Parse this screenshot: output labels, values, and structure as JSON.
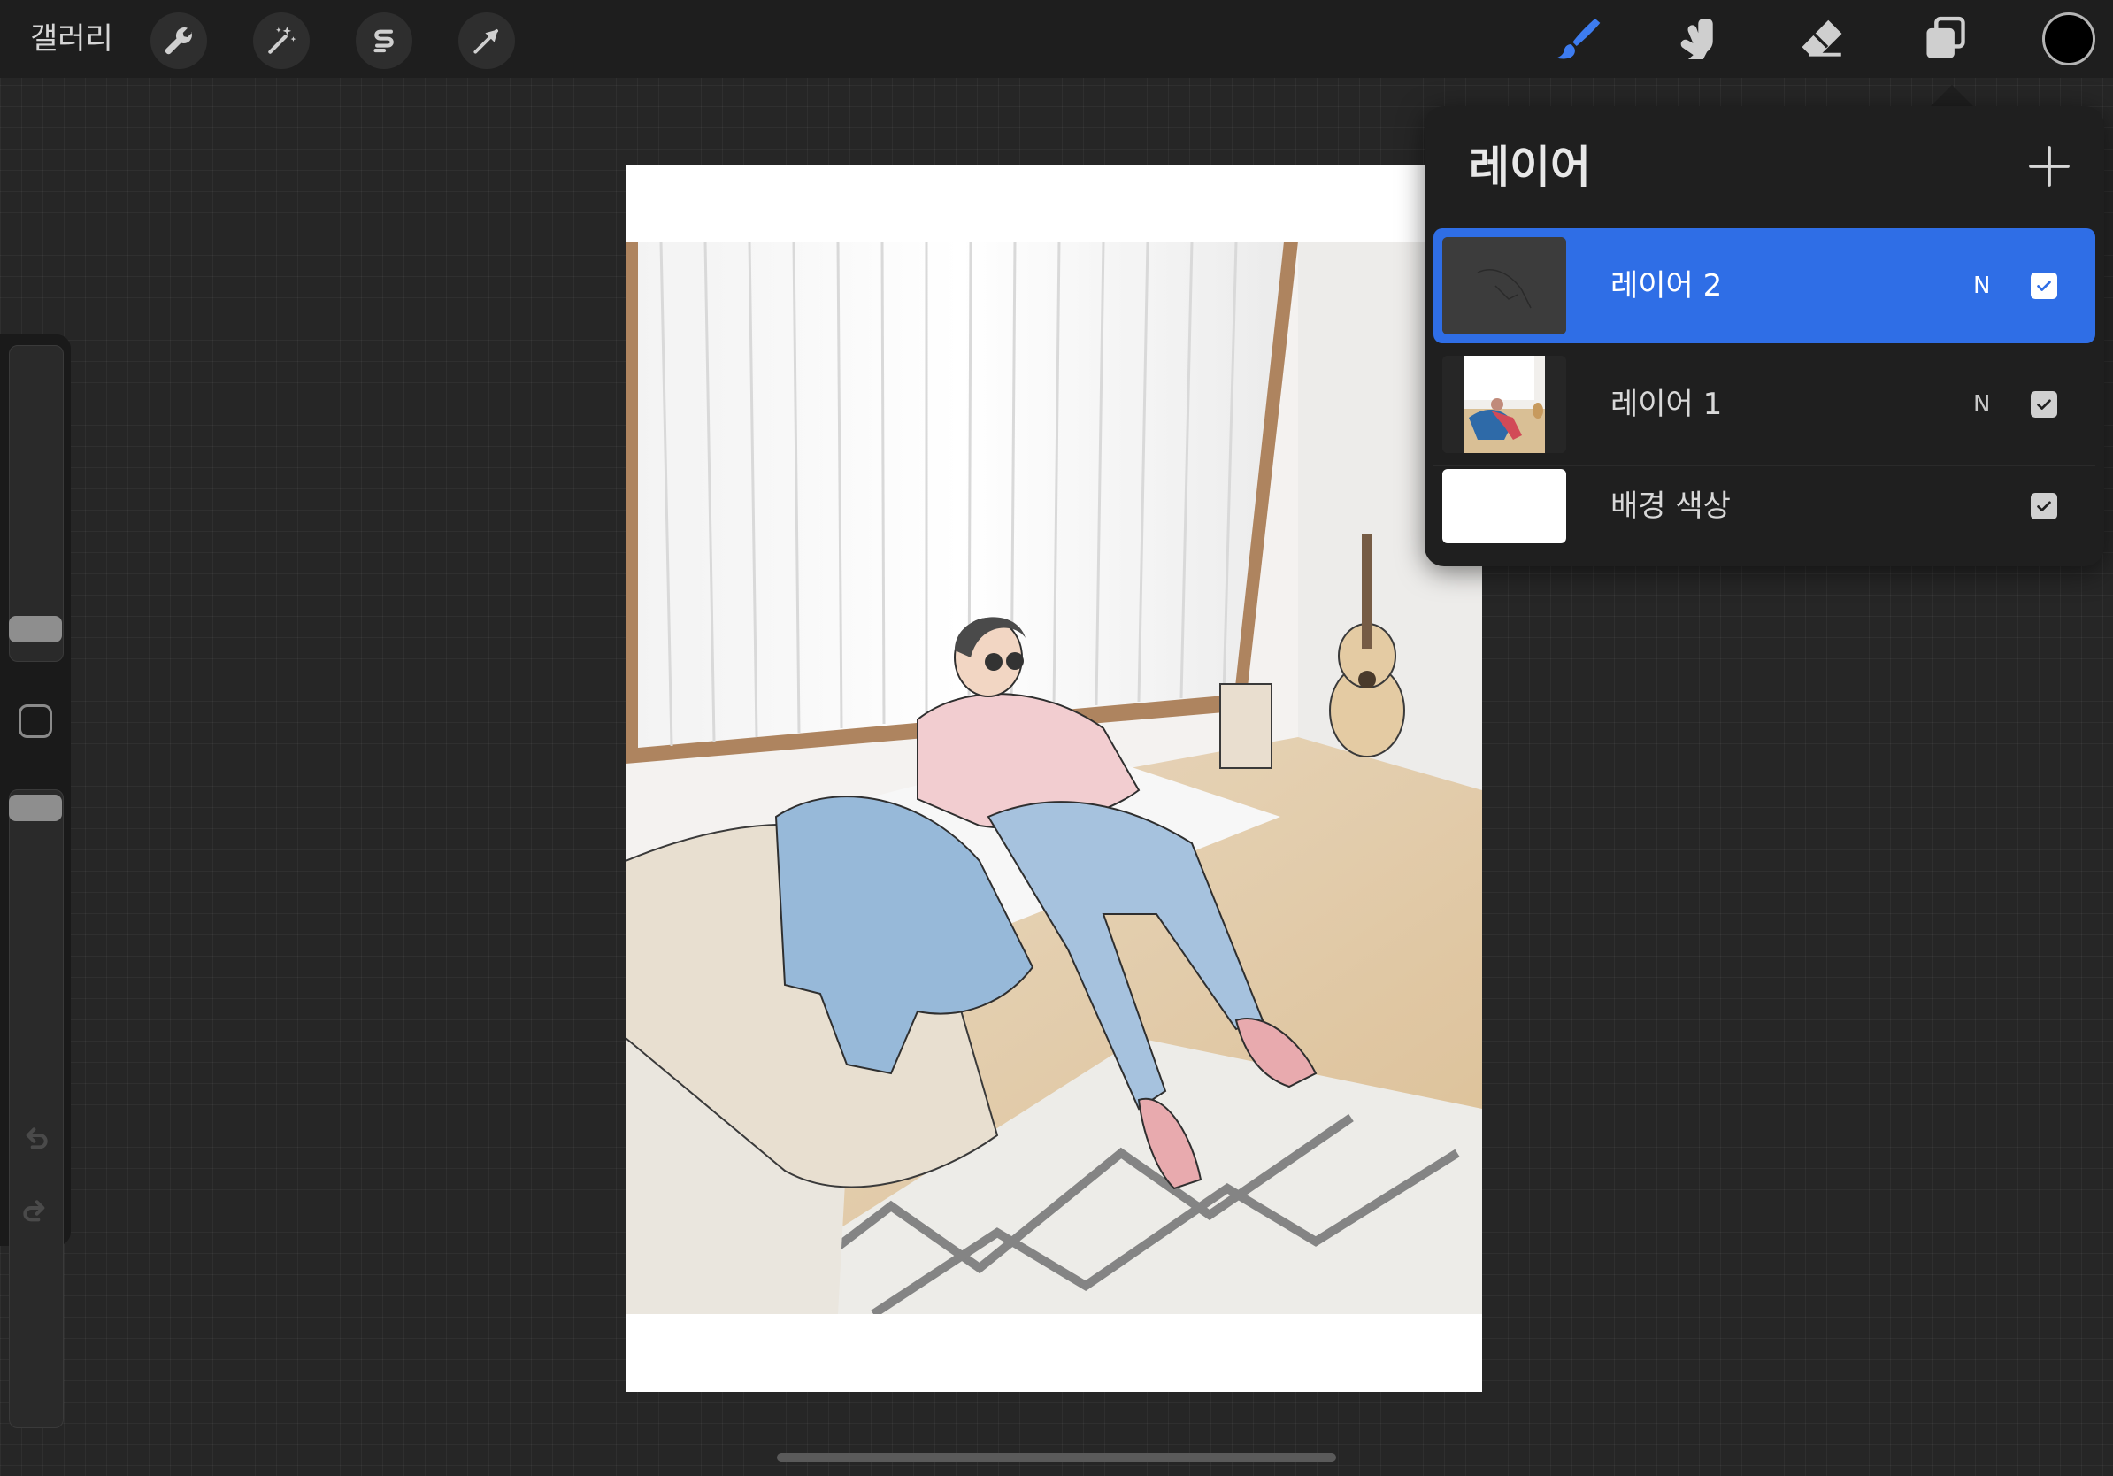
{
  "toolbar": {
    "gallery_label": "갤러리",
    "left_tools": [
      {
        "name": "actions",
        "icon": "wrench-icon"
      },
      {
        "name": "adjustments",
        "icon": "magic-wand-icon"
      },
      {
        "name": "selection",
        "icon": "selection-s-icon"
      },
      {
        "name": "transform",
        "icon": "arrow-cursor-icon"
      }
    ],
    "right_tools": [
      {
        "name": "brush",
        "icon": "brush-icon",
        "active": true
      },
      {
        "name": "smudge",
        "icon": "smudge-icon"
      },
      {
        "name": "eraser",
        "icon": "eraser-icon"
      },
      {
        "name": "layers",
        "icon": "layers-icon"
      }
    ],
    "current_color": "#000000",
    "accent_color": "#2f6ee6"
  },
  "layers_panel": {
    "title": "레이어",
    "layers": [
      {
        "name": "레이어 2",
        "blend_mode": "N",
        "visible": true,
        "active": true
      },
      {
        "name": "레이어 1",
        "blend_mode": "N",
        "visible": true,
        "active": false
      },
      {
        "name": "배경 색상",
        "blend_mode": "",
        "visible": true,
        "active": false
      }
    ]
  }
}
